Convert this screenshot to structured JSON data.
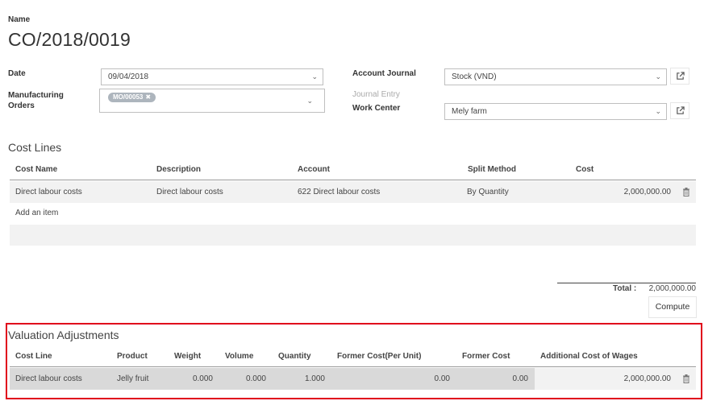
{
  "form": {
    "name_label": "Name",
    "record_title": "CO/2018/0019",
    "date_label": "Date",
    "date_value": "09/04/2018",
    "mo_label_line1": "Manufacturing",
    "mo_label_line2": "Orders",
    "mo_tag": "MO/00053",
    "account_journal_label": "Account Journal",
    "account_journal_value": "Stock (VND)",
    "journal_entry_label": "Journal Entry",
    "work_center_label": "Work Center",
    "work_center_value": "Mely farm"
  },
  "cost_lines": {
    "title": "Cost Lines",
    "headers": [
      "Cost Name",
      "Description",
      "Account",
      "Split Method",
      "Cost"
    ],
    "rows": [
      {
        "cost_name": "Direct labour costs",
        "description": "Direct labour costs",
        "account": "622 Direct labour costs",
        "split_method": "By Quantity",
        "cost": "2,000,000.00"
      }
    ],
    "add_item": "Add an item"
  },
  "totals": {
    "total_label": "Total :",
    "total_value": "2,000,000.00",
    "compute_button": "Compute"
  },
  "valuation": {
    "title": "Valuation Adjustments",
    "headers": [
      "Cost Line",
      "Product",
      "Weight",
      "Volume",
      "Quantity",
      "Former Cost(Per Unit)",
      "Former Cost",
      "Additional Cost of Wages"
    ],
    "rows": [
      {
        "cost_line": "Direct labour costs",
        "product": "Jelly fruit",
        "weight": "0.000",
        "volume": "0.000",
        "quantity": "1.000",
        "former_cost_unit": "0.00",
        "former_cost": "0.00",
        "additional_cost": "2,000,000.00"
      }
    ]
  },
  "colors": {
    "highlight_border": "#e0001b",
    "readonly_cell_bg": "#d9d9d9",
    "row_bg": "#f2f2f2",
    "tag_bg": "#adb5bd"
  },
  "icons": {
    "dropdown": "chevron-down-icon",
    "external_link": "external-link-icon",
    "delete": "trash-icon",
    "tag_remove": "close-icon"
  }
}
